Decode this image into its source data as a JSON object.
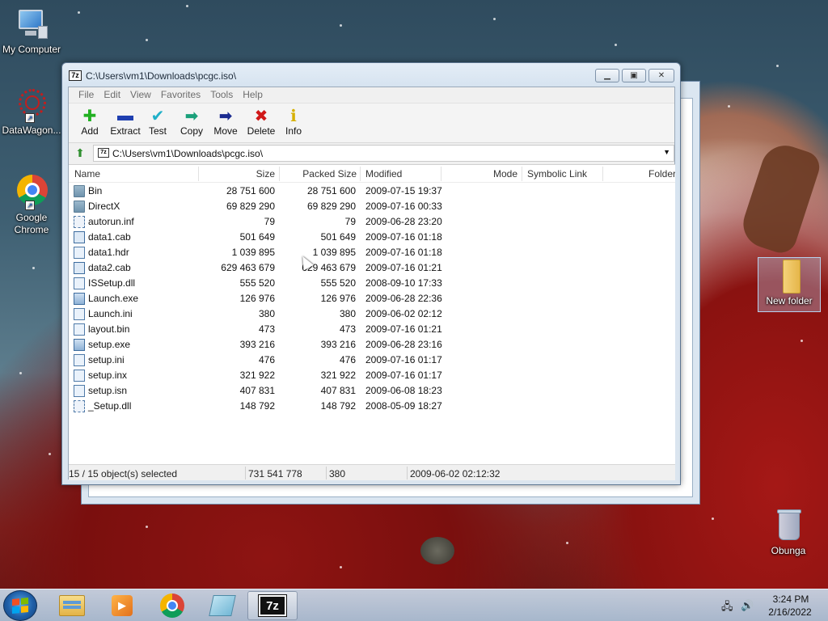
{
  "desktop": {
    "icons": [
      {
        "label": "My Computer",
        "icon": "computer-icon"
      },
      {
        "label": "DataWagon...",
        "icon": "datawagon-icon"
      },
      {
        "label": "Google Chrome",
        "icon": "chrome-icon"
      },
      {
        "label": "New folder",
        "icon": "folder-icon"
      },
      {
        "label": "Obunga",
        "icon": "recycle-bin-icon"
      }
    ]
  },
  "window": {
    "title": "C:\\Users\\vm1\\Downloads\\pcgc.iso\\",
    "app_icon_text": "7z",
    "menu": [
      "File",
      "Edit",
      "View",
      "Favorites",
      "Tools",
      "Help"
    ],
    "toolbar": [
      {
        "label": "Add",
        "icon": "plus-icon",
        "color": "#22b022"
      },
      {
        "label": "Extract",
        "icon": "minus-icon",
        "color": "#1f3fb0"
      },
      {
        "label": "Test",
        "icon": "check-icon",
        "color": "#20b0c8"
      },
      {
        "label": "Copy",
        "icon": "copy-arrow-icon",
        "color": "#1aa07a"
      },
      {
        "label": "Move",
        "icon": "move-arrow-icon",
        "color": "#1a2a90"
      },
      {
        "label": "Delete",
        "icon": "delete-x-icon",
        "color": "#d01818"
      },
      {
        "label": "Info",
        "icon": "info-icon",
        "color": "#d6b000"
      }
    ],
    "address": "C:\\Users\\vm1\\Downloads\\pcgc.iso\\",
    "columns": [
      "Name",
      "Size",
      "Packed Size",
      "Modified",
      "Mode",
      "Symbolic Link",
      "Folder"
    ],
    "files": [
      {
        "name": "Bin",
        "type": "folder",
        "size": "28 751 600",
        "packed": "28 751 600",
        "modified": "2009-07-15 19:37"
      },
      {
        "name": "DirectX",
        "type": "folder",
        "size": "69 829 290",
        "packed": "69 829 290",
        "modified": "2009-07-16 00:33"
      },
      {
        "name": "autorun.inf",
        "type": "dll",
        "size": "79",
        "packed": "79",
        "modified": "2009-06-28 23:20"
      },
      {
        "name": "data1.cab",
        "type": "cab",
        "size": "501 649",
        "packed": "501 649",
        "modified": "2009-07-16 01:18"
      },
      {
        "name": "data1.hdr",
        "type": "file",
        "size": "1 039 895",
        "packed": "1 039 895",
        "modified": "2009-07-16 01:18"
      },
      {
        "name": "data2.cab",
        "type": "cab",
        "size": "629 463 679",
        "packed": "629 463 679",
        "modified": "2009-07-16 01:21"
      },
      {
        "name": "ISSetup.dll",
        "type": "file",
        "size": "555 520",
        "packed": "555 520",
        "modified": "2008-09-10 17:33"
      },
      {
        "name": "Launch.exe",
        "type": "exe",
        "size": "126 976",
        "packed": "126 976",
        "modified": "2009-06-28 22:36"
      },
      {
        "name": "Launch.ini",
        "type": "file",
        "size": "380",
        "packed": "380",
        "modified": "2009-06-02 02:12"
      },
      {
        "name": "layout.bin",
        "type": "file",
        "size": "473",
        "packed": "473",
        "modified": "2009-07-16 01:21"
      },
      {
        "name": "setup.exe",
        "type": "exe",
        "size": "393 216",
        "packed": "393 216",
        "modified": "2009-06-28 23:16"
      },
      {
        "name": "setup.ini",
        "type": "file",
        "size": "476",
        "packed": "476",
        "modified": "2009-07-16 01:17"
      },
      {
        "name": "setup.inx",
        "type": "file",
        "size": "321 922",
        "packed": "321 922",
        "modified": "2009-07-16 01:17"
      },
      {
        "name": "setup.isn",
        "type": "file",
        "size": "407 831",
        "packed": "407 831",
        "modified": "2009-06-08 18:23"
      },
      {
        "name": "_Setup.dll",
        "type": "dll",
        "size": "148 792",
        "packed": "148 792",
        "modified": "2008-05-09 18:27"
      }
    ],
    "status": {
      "selection": "15 / 15 object(s) selected",
      "total_size": "731 541 778",
      "focused_size": "380",
      "focused_modified": "2009-06-02 02:12:32"
    }
  },
  "taskbar": {
    "apps": [
      {
        "name": "explorer",
        "icon": "folder-icon"
      },
      {
        "name": "media player",
        "icon": "media-player-icon"
      },
      {
        "name": "chrome",
        "icon": "chrome-icon"
      },
      {
        "name": "notepad",
        "icon": "notepad-icon"
      },
      {
        "name": "7-Zip",
        "icon": "7zip-icon",
        "active": true,
        "text": "7z"
      }
    ],
    "time": "3:24 PM",
    "date": "2/16/2022"
  }
}
